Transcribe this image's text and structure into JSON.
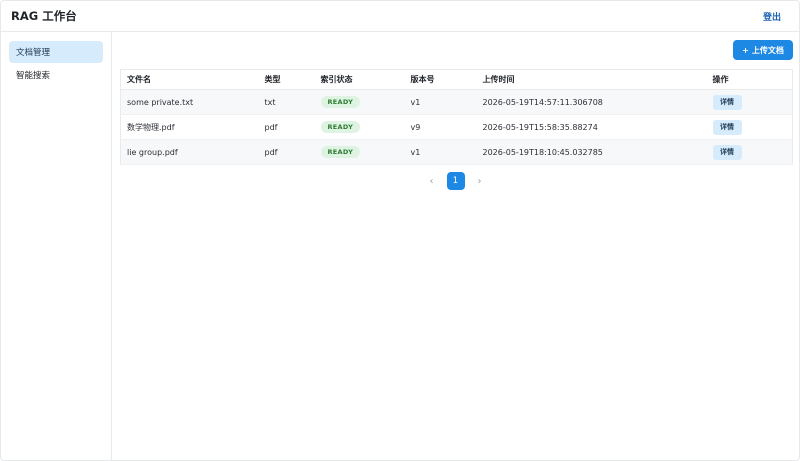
{
  "header": {
    "title": "RAG 工作台",
    "logout_label": "登出"
  },
  "sidebar": {
    "items": [
      {
        "label": "文档管理",
        "active": true
      },
      {
        "label": "智能搜索",
        "active": false
      }
    ]
  },
  "toolbar": {
    "upload_label": "上传文档",
    "upload_icon": "+"
  },
  "table": {
    "columns": [
      "文件名",
      "类型",
      "索引状态",
      "版本号",
      "上传时间",
      "操作"
    ],
    "rows": [
      {
        "name": "some private.txt",
        "type": "txt",
        "status": "READY",
        "version": "v1",
        "uploaded": "2026-05-19T14:57:11.306708",
        "action": "详情"
      },
      {
        "name": "数学物理.pdf",
        "type": "pdf",
        "status": "READY",
        "version": "v9",
        "uploaded": "2026-05-19T15:58:35.88274",
        "action": "详情"
      },
      {
        "name": "lie group.pdf",
        "type": "pdf",
        "status": "READY",
        "version": "v1",
        "uploaded": "2026-05-19T18:10:45.032785",
        "action": "详情"
      }
    ]
  },
  "pagination": {
    "prev_icon": "‹",
    "current_page": "1",
    "next_icon": "›"
  },
  "colors": {
    "accent": "#1e88e5",
    "active_nav": "#d6ebfb",
    "ready_badge_bg": "#dff3e3",
    "ready_badge_text": "#2e7d32"
  }
}
